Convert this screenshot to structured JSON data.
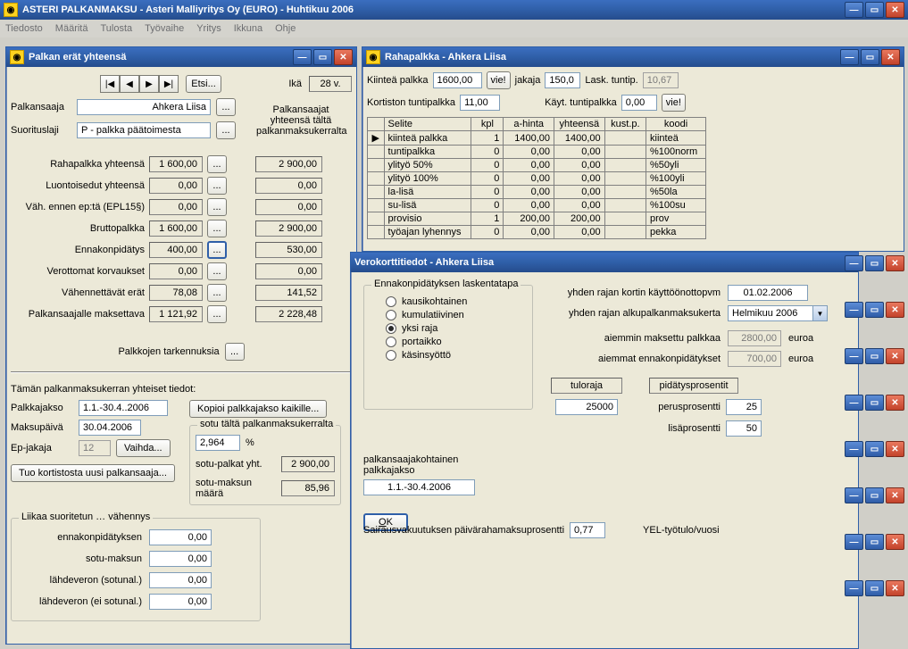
{
  "app": {
    "title": "ASTERI PALKANMAKSU - Asteri Malliyritys Oy (EURO) - Huhtikuu 2006"
  },
  "menu": [
    "Tiedosto",
    "Määritä",
    "Tulosta",
    "Työvaihe",
    "Yritys",
    "Ikkuna",
    "Ohje"
  ],
  "win1": {
    "title": "Palkan erät yhteensä",
    "etsi": "Etsi...",
    "ika_lbl": "Ikä",
    "ika_val": "28 v.",
    "palkansaaja_lbl": "Palkansaaja",
    "palkansaaja_val": "Ahkera Liisa",
    "suorituslaji_lbl": "Suorituslaji",
    "suorituslaji_val": "P    - palkka päätoimesta",
    "sumhdr": "Palkansaajat\nyhteensä tältä\npalkanmaksukerralta",
    "rows": [
      {
        "label": "Rahapalkka yhteensä",
        "v1": "1 600,00",
        "v2": "2 900,00"
      },
      {
        "label": "Luontoisedut yhteensä",
        "v1": "0,00",
        "v2": "0,00"
      },
      {
        "label": "Väh. ennen ep:tä (EPL15§)",
        "v1": "0,00",
        "v2": "0,00"
      },
      {
        "label": "Bruttopalkka",
        "v1": "1 600,00",
        "v2": "2 900,00"
      },
      {
        "label": "Ennakonpidätys",
        "v1": "400,00",
        "v2": "530,00"
      },
      {
        "label": "Verottomat korvaukset",
        "v1": "0,00",
        "v2": "0,00"
      },
      {
        "label": "Vähennettävät erät",
        "v1": "78,08",
        "v2": "141,52"
      },
      {
        "label": "Palkansaajalle maksettava",
        "v1": "1 121,92",
        "v2": "2 228,48"
      }
    ],
    "tarkennuksia": "Palkkojen tarkennuksia",
    "kerta_hdr": "Tämän palkanmaksukerran yhteiset tiedot:",
    "palkkajakso_lbl": "Palkkajakso",
    "palkkajakso_val": "1.1.-30.4..2006",
    "kopioi": "Kopioi palkkajakso kaikille...",
    "maksupaiva_lbl": "Maksupäivä",
    "maksupaiva_val": "30.04.2006",
    "epjakaja_lbl": "Ep-jakaja",
    "epjakaja_val": "12",
    "vaihda": "Vaihda...",
    "tuo": "Tuo kortistosta uusi palkansaaja...",
    "sotu_legend": "sotu tältä palkanmaksukerralta",
    "sotu_pct": "2,964",
    "pct": "%",
    "sotu_palkat_lbl": "sotu-palkat yht.",
    "sotu_palkat": "2 900,00",
    "sotu_maara_lbl": "sotu-maksun määrä",
    "sotu_maara": "85,96",
    "liikaa_legend": "Liikaa suoritetun … vähennys",
    "liikaa": [
      {
        "label": "ennakonpidätyksen",
        "v": "0,00"
      },
      {
        "label": "sotu-maksun",
        "v": "0,00"
      },
      {
        "label": "lähdeveron (sotunal.)",
        "v": "0,00"
      },
      {
        "label": "lähdeveron (ei sotunal.)",
        "v": "0,00"
      }
    ]
  },
  "win2": {
    "title": "Rahapalkka - Ahkera Liisa",
    "kiintea_lbl": "Kiinteä palkka",
    "kiintea_val": "1600,00",
    "vie": "vie!",
    "jakaja_lbl": "jakaja",
    "jakaja_val": "150,0",
    "lask_lbl": "Lask. tuntip.",
    "lask_val": "10,67",
    "kortiston_lbl": "Kortiston tuntipalkka",
    "kortiston_val": "11,00",
    "kayt_lbl": "Käyt. tuntipalkka",
    "kayt_val": "0,00",
    "gridhdr": [
      "Selite",
      "kpl",
      "a-hinta",
      "yhteensä",
      "kust.p.",
      "koodi"
    ],
    "gridrows": [
      {
        "sel": "kiinteä palkka",
        "kpl": "1",
        "ah": "1400,00",
        "yh": "1400,00",
        "kp": "",
        "koodi": "kiinteä",
        "ptr": true
      },
      {
        "sel": "tuntipalkka",
        "kpl": "0",
        "ah": "0,00",
        "yh": "0,00",
        "kp": "",
        "koodi": "%100norm"
      },
      {
        "sel": "ylityö 50%",
        "kpl": "0",
        "ah": "0,00",
        "yh": "0,00",
        "kp": "",
        "koodi": "%50yli"
      },
      {
        "sel": "ylityö 100%",
        "kpl": "0",
        "ah": "0,00",
        "yh": "0,00",
        "kp": "",
        "koodi": "%100yli"
      },
      {
        "sel": "la-lisä",
        "kpl": "0",
        "ah": "0,00",
        "yh": "0,00",
        "kp": "",
        "koodi": "%50la"
      },
      {
        "sel": "su-lisä",
        "kpl": "0",
        "ah": "0,00",
        "yh": "0,00",
        "kp": "",
        "koodi": "%100su"
      },
      {
        "sel": "provisio",
        "kpl": "1",
        "ah": "200,00",
        "yh": "200,00",
        "kp": "",
        "koodi": "prov"
      },
      {
        "sel": "työajan lyhennys",
        "kpl": "0",
        "ah": "0,00",
        "yh": "0,00",
        "kp": "",
        "koodi": "pekka"
      }
    ]
  },
  "win3": {
    "title": "Verokorttitiedot - Ahkera Liisa",
    "grp": "Ennakonpidätyksen laskentatapa",
    "radios": [
      "kausikohtainen",
      "kumulatiivinen",
      "yksi raja",
      "portaikko",
      "käsinsyöttö"
    ],
    "selected": 2,
    "kayttoonotto_lbl": "yhden rajan kortin käyttöönottopvm",
    "kayttoonotto_val": "01.02.2006",
    "alku_lbl": "yhden rajan alkupalkanmaksukerta",
    "alku_val": "Helmikuu 2006",
    "aiemmin_pal_lbl": "aiemmin maksettu palkkaa",
    "aiemmin_pal_val": "2800,00",
    "aiemmat_ep_lbl": "aiemmat ennakonpidätykset",
    "aiemmat_ep_val": "700,00",
    "euroa": "euroa",
    "tuloraja_lbl": "tuloraja",
    "tuloraja_val": "25000",
    "pidatys_lbl": "pidätysprosentit",
    "perus_lbl": "perusprosentti",
    "perus_val": "25",
    "lisa_lbl": "lisäprosentti",
    "lisa_val": "50",
    "pkoht": "palkansaajakohtainen",
    "pjakso": "palkkajakso",
    "pjakso_val": "1.1.-30.4.2006",
    "ok": "OK",
    "sair_lbl": "Sairausvakuutuksen päivärahamaksuprosentti",
    "sair_val": "0,77",
    "yel_lbl": "YEL-työtulo/vuosi"
  }
}
